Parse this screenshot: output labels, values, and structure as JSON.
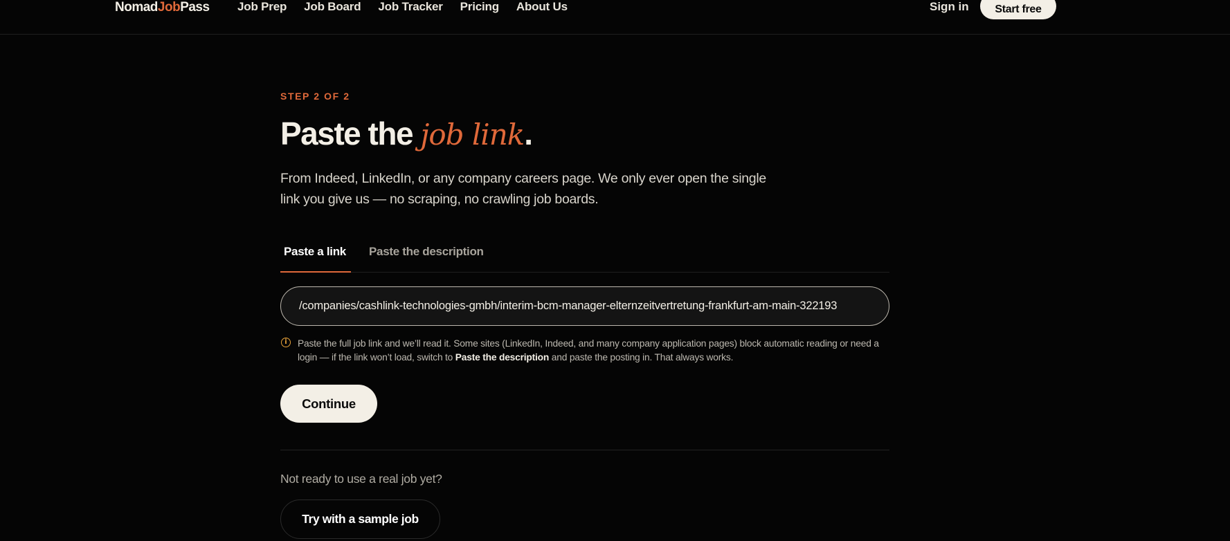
{
  "brand": {
    "part1": "Nomad",
    "part2": "Job",
    "part3": "Pass",
    "accent_color": "#e0693a"
  },
  "nav": {
    "items": [
      {
        "label": "Job Prep"
      },
      {
        "label": "Job Board"
      },
      {
        "label": "Job Tracker"
      },
      {
        "label": "Pricing"
      },
      {
        "label": "About Us"
      }
    ],
    "signin_label": "Sign in",
    "start_label": "Start free"
  },
  "step_label": "STEP 2 OF 2",
  "title": {
    "prefix": "Paste the ",
    "accent": "job link",
    "suffix": "."
  },
  "subtitle": "From Indeed, LinkedIn, or any company careers page. We only ever open the single link you give us — no scraping, no crawling job boards.",
  "tabs": [
    {
      "label": "Paste a link",
      "active": true
    },
    {
      "label": "Paste the description",
      "active": false
    }
  ],
  "url_input": {
    "value": "/companies/cashlink-technologies-gmbh/interim-bcm-manager-elternzeitvertretung-frankfurt-am-main-322193"
  },
  "hint": {
    "icon": "info-icon",
    "text_before": "Paste the full job link and we’ll read it. Some sites (LinkedIn, Indeed, and many company application pages) block automatic reading or need a login — if the link won’t load, switch to ",
    "text_bold": "Paste the description",
    "text_after": " and paste the posting in. That always works."
  },
  "continue_label": "Continue",
  "not_ready": "Not ready to use a real job yet?",
  "sample_label": "Try with a sample job"
}
